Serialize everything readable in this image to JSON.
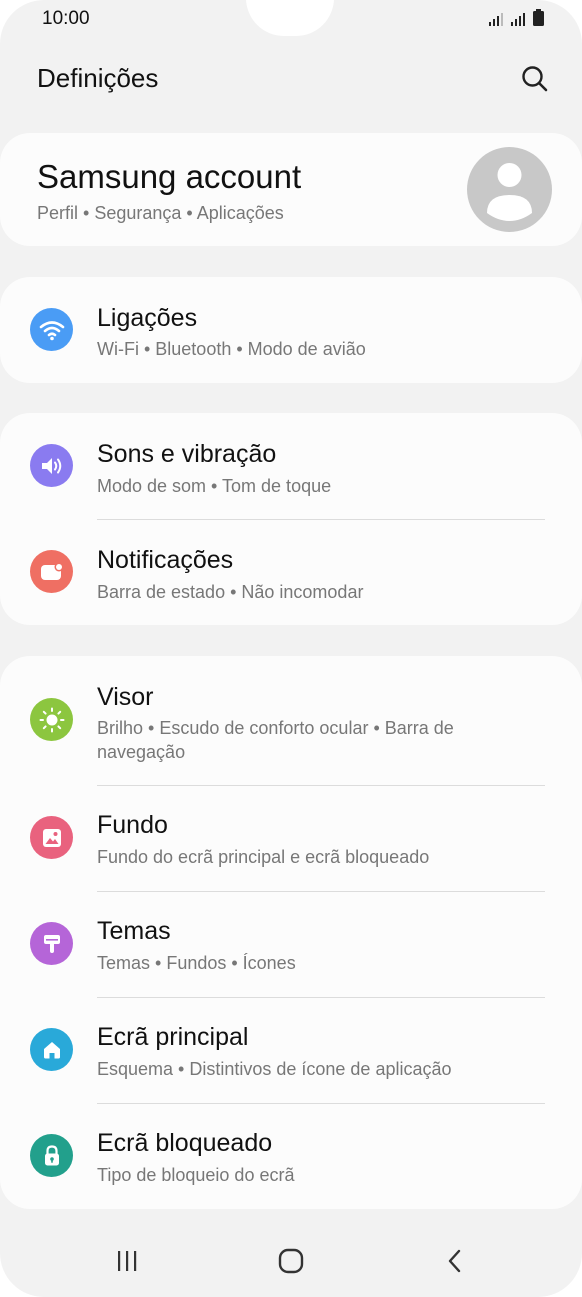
{
  "status_bar": {
    "time": "10:00"
  },
  "header": {
    "title": "Definições"
  },
  "account": {
    "title": "Samsung account",
    "subtitle": "Perfil  •  Segurança  •  Aplicações"
  },
  "items": [
    {
      "title": "Ligações",
      "subtitle": "Wi-Fi  •  Bluetooth  •  Modo de avião",
      "icon": "wifi-icon",
      "color": "#4a9cf5"
    },
    {
      "title": "Sons e vibração",
      "subtitle": "Modo de som  •  Tom de toque",
      "icon": "volume-icon",
      "color": "#8a7bf0"
    },
    {
      "title": "Notificações",
      "subtitle": "Barra de estado  •  Não incomodar",
      "icon": "notification-icon",
      "color": "#ef6f63"
    },
    {
      "title": "Visor",
      "subtitle": "Brilho  •  Escudo de conforto ocular  •  Barra de navegação",
      "icon": "brightness-icon",
      "color": "#8cc63f"
    },
    {
      "title": "Fundo",
      "subtitle": "Fundo do ecrã principal e ecrã bloqueado",
      "icon": "wallpaper-icon",
      "color": "#e9627e"
    },
    {
      "title": "Temas",
      "subtitle": "Temas  •  Fundos  •  Ícones",
      "icon": "theme-brush-icon",
      "color": "#b565d8"
    },
    {
      "title": "Ecrã principal",
      "subtitle": "Esquema  •  Distintivos de ícone de aplicação",
      "icon": "home-icon",
      "color": "#29a9d9"
    },
    {
      "title": "Ecrã bloqueado",
      "subtitle": "Tipo de bloqueio do ecrã",
      "icon": "lock-icon",
      "color": "#22a08c"
    }
  ],
  "nav": {
    "recents": "recents-icon",
    "home": "home-circle-icon",
    "back": "back-icon"
  }
}
